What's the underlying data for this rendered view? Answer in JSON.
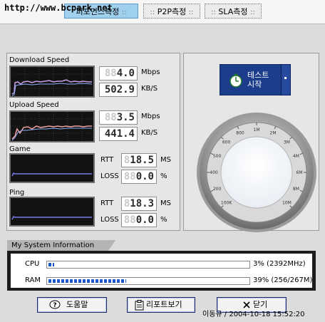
{
  "watermark": "http://www.bcpark.net",
  "tabs": [
    {
      "label": "퍼포먼스측정",
      "active": true
    },
    {
      "label": "P2P측정",
      "active": false
    },
    {
      "label": "SLA측정",
      "active": false
    }
  ],
  "tab_dots": "::",
  "download": {
    "label": "Download Speed",
    "mbps_ghost": "88",
    "mbps": "4.0",
    "mbps_unit": "Mbps",
    "kbs_ghost": "",
    "kbs": "502.9",
    "kbs_unit": "KB/S"
  },
  "upload": {
    "label": "Upload Speed",
    "mbps_ghost": "88",
    "mbps": "3.5",
    "mbps_unit": "Mbps",
    "kbs_ghost": "",
    "kbs": "441.4",
    "kbs_unit": "KB/S"
  },
  "game": {
    "label": "Game",
    "rtt_label": "RTT",
    "rtt_ghost": "8",
    "rtt": "18.5",
    "rtt_unit": "MS",
    "loss_label": "LOSS",
    "loss_ghost": "88",
    "loss": "0.0",
    "loss_unit": "%"
  },
  "ping": {
    "label": "Ping",
    "rtt_label": "RTT",
    "rtt_ghost": "8",
    "rtt": "18.3",
    "rtt_unit": "MS",
    "loss_label": "LOSS",
    "loss_ghost": "88",
    "loss": "0.0",
    "loss_unit": "%"
  },
  "start_button": {
    "line1": "테스트",
    "line2": "시작"
  },
  "gauge": {
    "ticks": [
      "100K",
      "200",
      "400",
      "500",
      "600",
      "800",
      "1M",
      "2M",
      "3M",
      "4M",
      "6M",
      "8M",
      "10M"
    ]
  },
  "system": {
    "title": "My System Information",
    "cpu_label": "CPU",
    "cpu_percent": 3,
    "cpu_value": "3% (2392MHz)",
    "ram_label": "RAM",
    "ram_percent": 39,
    "ram_value": "39% (256/267M)"
  },
  "buttons": {
    "help": "도움말",
    "report": "리포트보기",
    "close": "닫기"
  },
  "footer": "이동규 / 2004-10-18 15:52:20",
  "colors": {
    "graph_bg": "#121212",
    "download_line": "#c8a0e8",
    "download_line2": "#8fb0ff",
    "upload_line": "#f0a0a0",
    "flat_line": "#7a7ae8",
    "start_button": "#1c3d8c",
    "progress": "#1f58c8"
  }
}
